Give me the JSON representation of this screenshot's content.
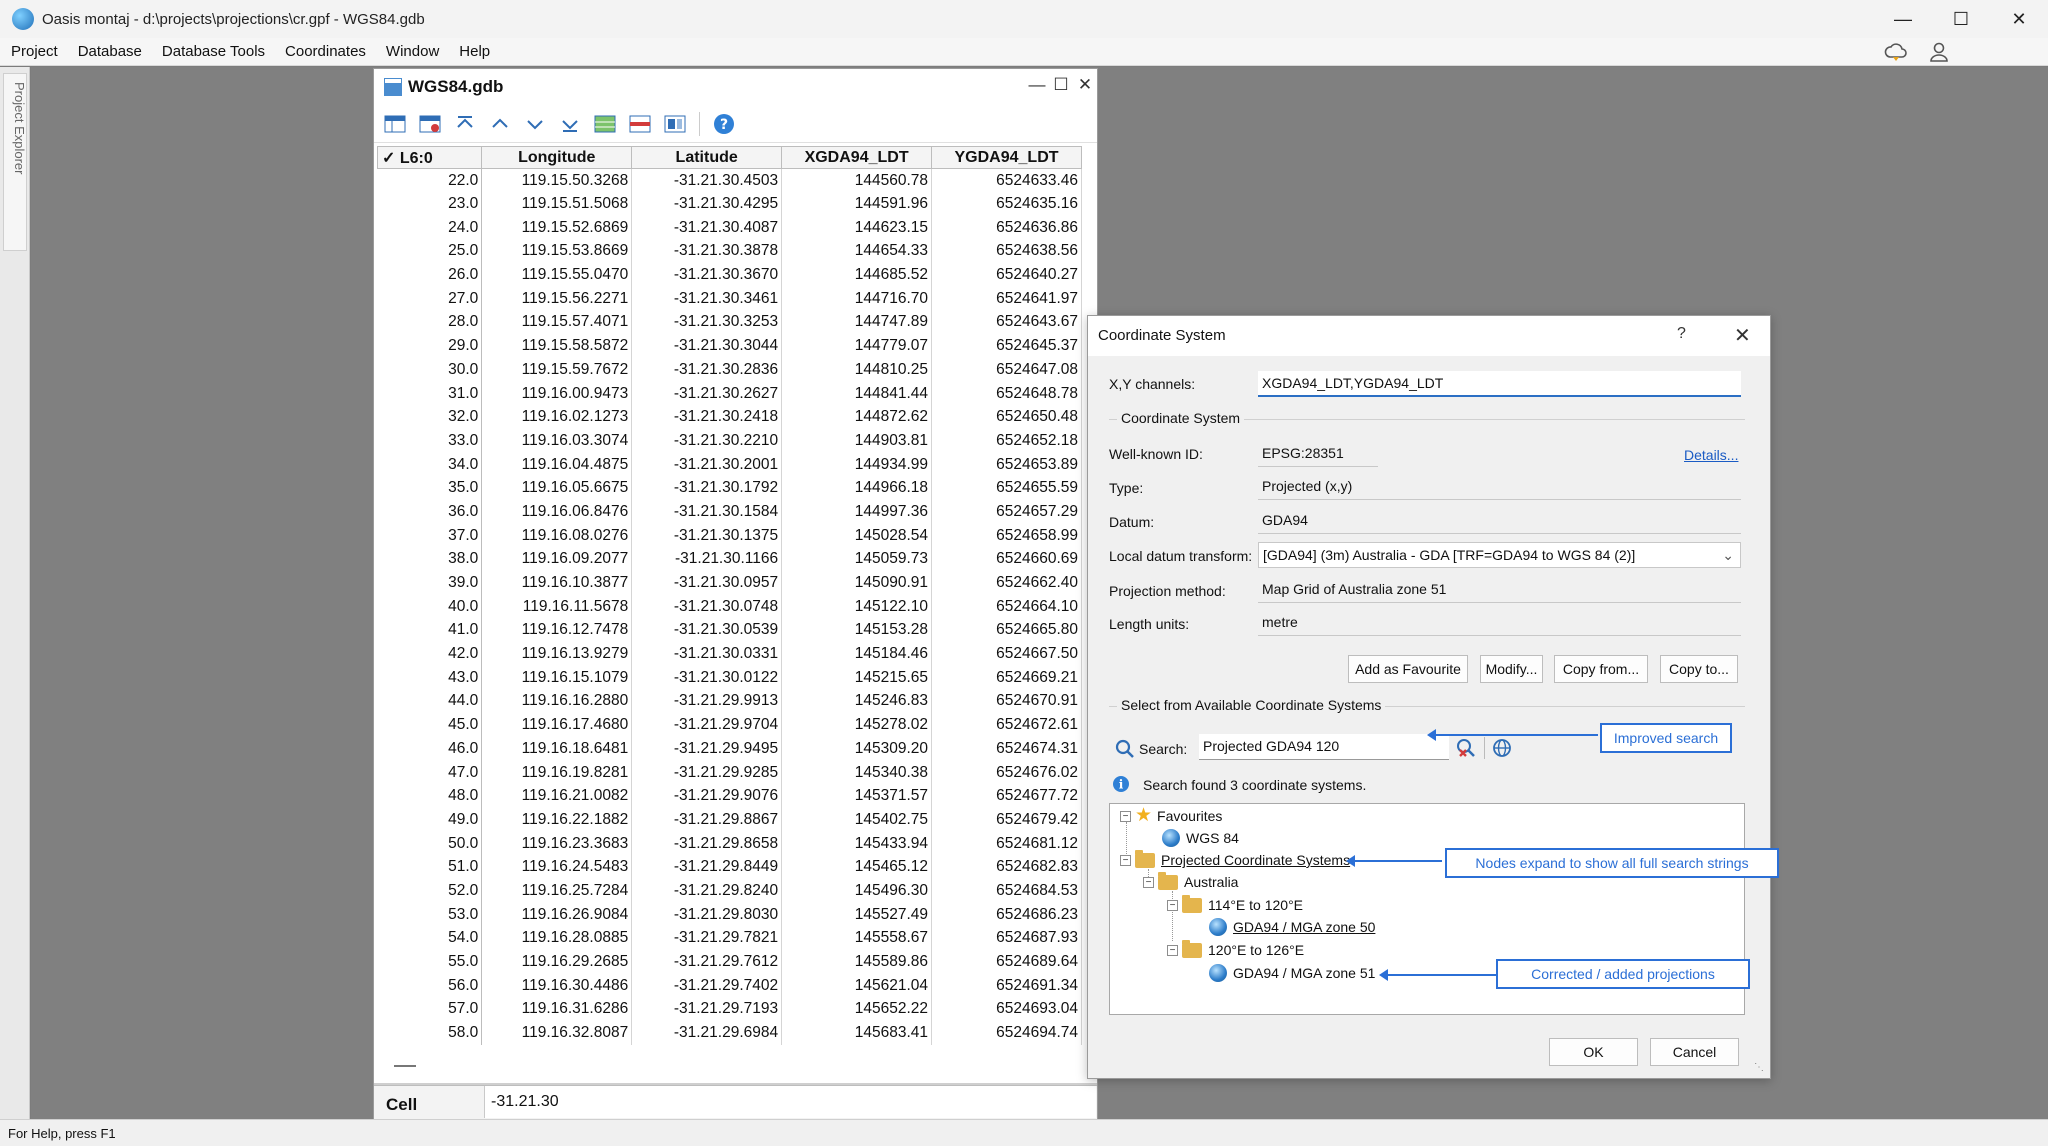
{
  "app": {
    "title": "Oasis montaj - d:\\projects\\projections\\cr.gpf - WGS84.gdb",
    "menu": [
      "Project",
      "Database",
      "Database Tools",
      "Coordinates",
      "Window",
      "Help"
    ],
    "status": "For Help, press F1",
    "side_panel_label": "Project Explorer"
  },
  "gdb": {
    "title": "WGS84.gdb",
    "toolbar_icons": [
      "add-channel-icon",
      "delete-channel-icon",
      "move-top-icon",
      "move-up-icon",
      "move-down-icon",
      "move-bottom-icon",
      "grid-view-icon",
      "profile-view-icon",
      "database-icon",
      "help-icon"
    ],
    "columns": [
      "L6:0",
      "Longitude",
      "Latitude",
      "XGDA94_LDT",
      "YGDA94_LDT"
    ],
    "rows": [
      [
        "22.0",
        "119.15.50.3268",
        "-31.21.30.4503",
        "144560.78",
        "6524633.46"
      ],
      [
        "23.0",
        "119.15.51.5068",
        "-31.21.30.4295",
        "144591.96",
        "6524635.16"
      ],
      [
        "24.0",
        "119.15.52.6869",
        "-31.21.30.4087",
        "144623.15",
        "6524636.86"
      ],
      [
        "25.0",
        "119.15.53.8669",
        "-31.21.30.3878",
        "144654.33",
        "6524638.56"
      ],
      [
        "26.0",
        "119.15.55.0470",
        "-31.21.30.3670",
        "144685.52",
        "6524640.27"
      ],
      [
        "27.0",
        "119.15.56.2271",
        "-31.21.30.3461",
        "144716.70",
        "6524641.97"
      ],
      [
        "28.0",
        "119.15.57.4071",
        "-31.21.30.3253",
        "144747.89",
        "6524643.67"
      ],
      [
        "29.0",
        "119.15.58.5872",
        "-31.21.30.3044",
        "144779.07",
        "6524645.37"
      ],
      [
        "30.0",
        "119.15.59.7672",
        "-31.21.30.2836",
        "144810.25",
        "6524647.08"
      ],
      [
        "31.0",
        "119.16.00.9473",
        "-31.21.30.2627",
        "144841.44",
        "6524648.78"
      ],
      [
        "32.0",
        "119.16.02.1273",
        "-31.21.30.2418",
        "144872.62",
        "6524650.48"
      ],
      [
        "33.0",
        "119.16.03.3074",
        "-31.21.30.2210",
        "144903.81",
        "6524652.18"
      ],
      [
        "34.0",
        "119.16.04.4875",
        "-31.21.30.2001",
        "144934.99",
        "6524653.89"
      ],
      [
        "35.0",
        "119.16.05.6675",
        "-31.21.30.1792",
        "144966.18",
        "6524655.59"
      ],
      [
        "36.0",
        "119.16.06.8476",
        "-31.21.30.1584",
        "144997.36",
        "6524657.29"
      ],
      [
        "37.0",
        "119.16.08.0276",
        "-31.21.30.1375",
        "145028.54",
        "6524658.99"
      ],
      [
        "38.0",
        "119.16.09.2077",
        "-31.21.30.1166",
        "145059.73",
        "6524660.69"
      ],
      [
        "39.0",
        "119.16.10.3877",
        "-31.21.30.0957",
        "145090.91",
        "6524662.40"
      ],
      [
        "40.0",
        "119.16.11.5678",
        "-31.21.30.0748",
        "145122.10",
        "6524664.10"
      ],
      [
        "41.0",
        "119.16.12.7478",
        "-31.21.30.0539",
        "145153.28",
        "6524665.80"
      ],
      [
        "42.0",
        "119.16.13.9279",
        "-31.21.30.0331",
        "145184.46",
        "6524667.50"
      ],
      [
        "43.0",
        "119.16.15.1079",
        "-31.21.30.0122",
        "145215.65",
        "6524669.21"
      ],
      [
        "44.0",
        "119.16.16.2880",
        "-31.21.29.9913",
        "145246.83",
        "6524670.91"
      ],
      [
        "45.0",
        "119.16.17.4680",
        "-31.21.29.9704",
        "145278.02",
        "6524672.61"
      ],
      [
        "46.0",
        "119.16.18.6481",
        "-31.21.29.9495",
        "145309.20",
        "6524674.31"
      ],
      [
        "47.0",
        "119.16.19.8281",
        "-31.21.29.9285",
        "145340.38",
        "6524676.02"
      ],
      [
        "48.0",
        "119.16.21.0082",
        "-31.21.29.9076",
        "145371.57",
        "6524677.72"
      ],
      [
        "49.0",
        "119.16.22.1882",
        "-31.21.29.8867",
        "145402.75",
        "6524679.42"
      ],
      [
        "50.0",
        "119.16.23.3683",
        "-31.21.29.8658",
        "145433.94",
        "6524681.12"
      ],
      [
        "51.0",
        "119.16.24.5483",
        "-31.21.29.8449",
        "145465.12",
        "6524682.83"
      ],
      [
        "52.0",
        "119.16.25.7284",
        "-31.21.29.8240",
        "145496.30",
        "6524684.53"
      ],
      [
        "53.0",
        "119.16.26.9084",
        "-31.21.29.8030",
        "145527.49",
        "6524686.23"
      ],
      [
        "54.0",
        "119.16.28.0885",
        "-31.21.29.7821",
        "145558.67",
        "6524687.93"
      ],
      [
        "55.0",
        "119.16.29.2685",
        "-31.21.29.7612",
        "145589.86",
        "6524689.64"
      ],
      [
        "56.0",
        "119.16.30.4486",
        "-31.21.29.7402",
        "145621.04",
        "6524691.34"
      ],
      [
        "57.0",
        "119.16.31.6286",
        "-31.21.29.7193",
        "145652.22",
        "6524693.04"
      ],
      [
        "58.0",
        "119.16.32.8087",
        "-31.21.29.6984",
        "145683.41",
        "6524694.74"
      ]
    ],
    "cell_label": "Cell",
    "cell_value": "-31.21.30"
  },
  "dialog": {
    "title": "Coordinate System",
    "help": "?",
    "xy_label": "X,Y channels:",
    "xy_value": "XGDA94_LDT,YGDA94_LDT",
    "group_cs": "Coordinate System",
    "wkid_label": "Well-known ID:",
    "wkid_value": "EPSG:28351",
    "details_link": "Details...",
    "type_label": "Type:",
    "type_value": "Projected (x,y)",
    "datum_label": "Datum:",
    "datum_value": "GDA94",
    "ldt_label": "Local datum transform:",
    "ldt_value": "[GDA94] (3m) Australia - GDA [TRF=GDA94 to WGS 84 (2)]",
    "proj_label": "Projection method:",
    "proj_value": "Map Grid of Australia zone 51",
    "units_label": "Length units:",
    "units_value": "metre",
    "btn_fav": "Add as Favourite",
    "btn_modify": "Modify...",
    "btn_copy_from": "Copy from...",
    "btn_copy_to": "Copy to...",
    "group_select": "Select from Available Coordinate Systems",
    "search_label": "Search:",
    "search_value": "Projected GDA94 120",
    "search_result": "Search found 3 coordinate systems.",
    "tree": {
      "favourites": "Favourites",
      "wgs84": "WGS 84",
      "projected": "Projected Coordinate Systems",
      "australia": "Australia",
      "range1": "114°E to 120°E",
      "zone50": "GDA94 / MGA zone 50",
      "range2": "120°E to 126°E",
      "zone51": "GDA94 / MGA zone 51"
    },
    "callout_search": "Improved search",
    "callout_nodes": "Nodes expand to show all full search strings",
    "callout_corrected": "Corrected / added projections",
    "ok": "OK",
    "cancel": "Cancel",
    "accent_color": "#2b6fd6"
  }
}
